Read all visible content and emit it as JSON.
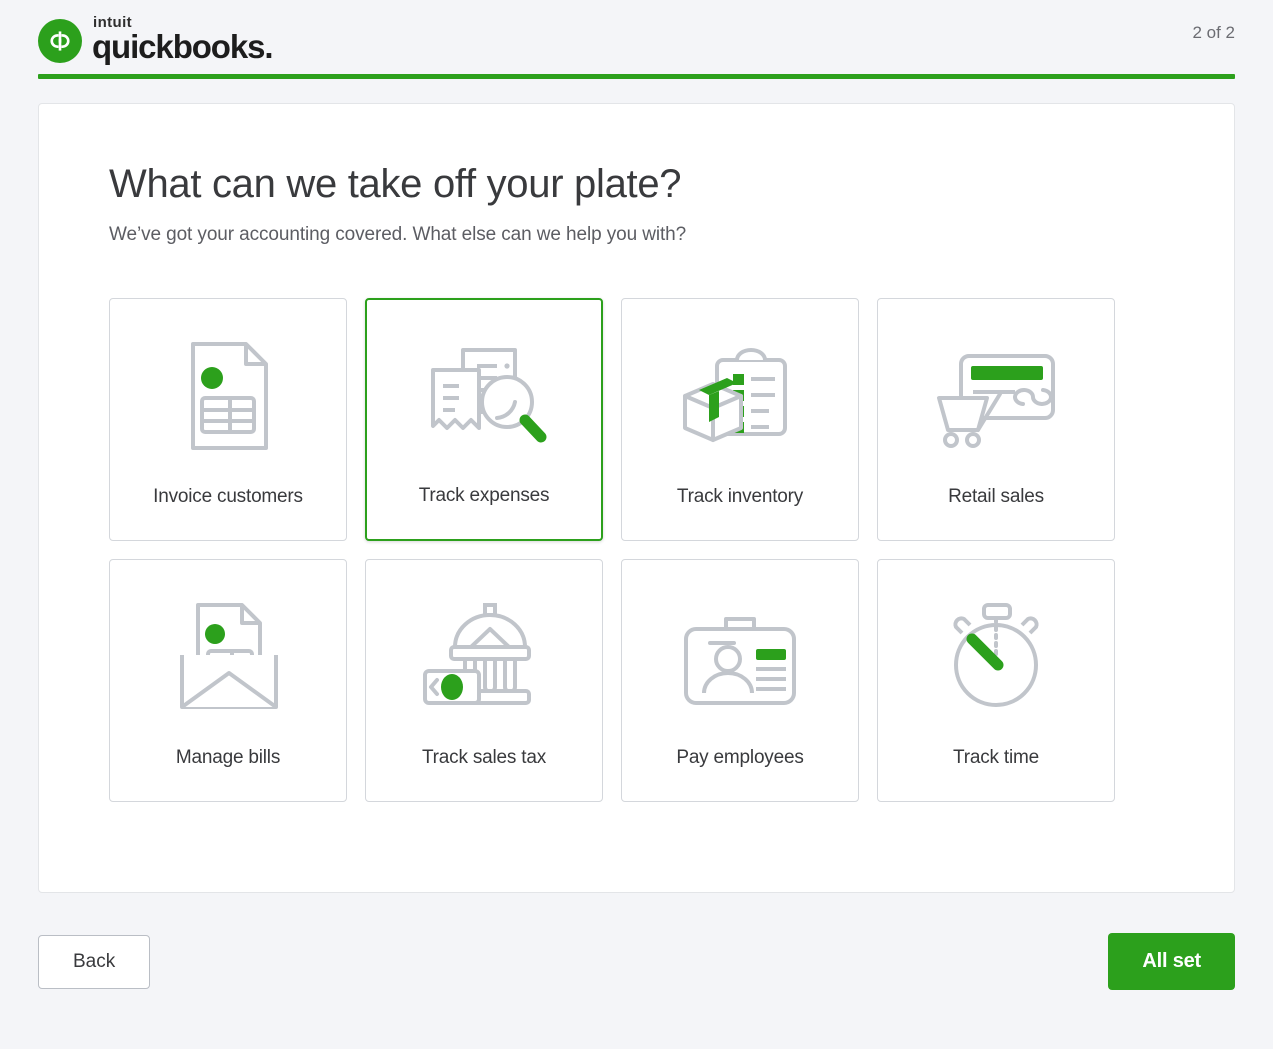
{
  "brand": {
    "intuit": "intuit",
    "quickbooks": "quickbooks.",
    "logo_color": "#2ca01c",
    "logo_glyph": "qb-logo-icon"
  },
  "header": {
    "step_counter": "2 of 2",
    "progress_percent": 100
  },
  "main": {
    "title": "What can we take off your plate?",
    "subtitle": "We’ve got your accounting covered. What else can we help you with?"
  },
  "options": [
    {
      "id": "invoice-customers",
      "label": "Invoice customers",
      "icon": "invoice-document-icon",
      "selected": false
    },
    {
      "id": "track-expenses",
      "label": "Track expenses",
      "icon": "receipt-magnifier-icon",
      "selected": true
    },
    {
      "id": "track-inventory",
      "label": "Track inventory",
      "icon": "box-clipboard-icon",
      "selected": false
    },
    {
      "id": "retail-sales",
      "label": "Retail sales",
      "icon": "card-cart-icon",
      "selected": false
    },
    {
      "id": "manage-bills",
      "label": "Manage bills",
      "icon": "envelope-invoice-icon",
      "selected": false
    },
    {
      "id": "track-sales-tax",
      "label": "Track sales tax",
      "icon": "bank-banknote-icon",
      "selected": false
    },
    {
      "id": "pay-employees",
      "label": "Pay employees",
      "icon": "id-badge-icon",
      "selected": false
    },
    {
      "id": "track-time",
      "label": "Track time",
      "icon": "stopwatch-icon",
      "selected": false
    }
  ],
  "footer": {
    "back_label": "Back",
    "submit_label": "All set"
  },
  "colors": {
    "green": "#2ca01c",
    "icon_gray": "#c1c5cb",
    "text_dark": "#393a3d",
    "page_bg": "#f4f5f8"
  }
}
